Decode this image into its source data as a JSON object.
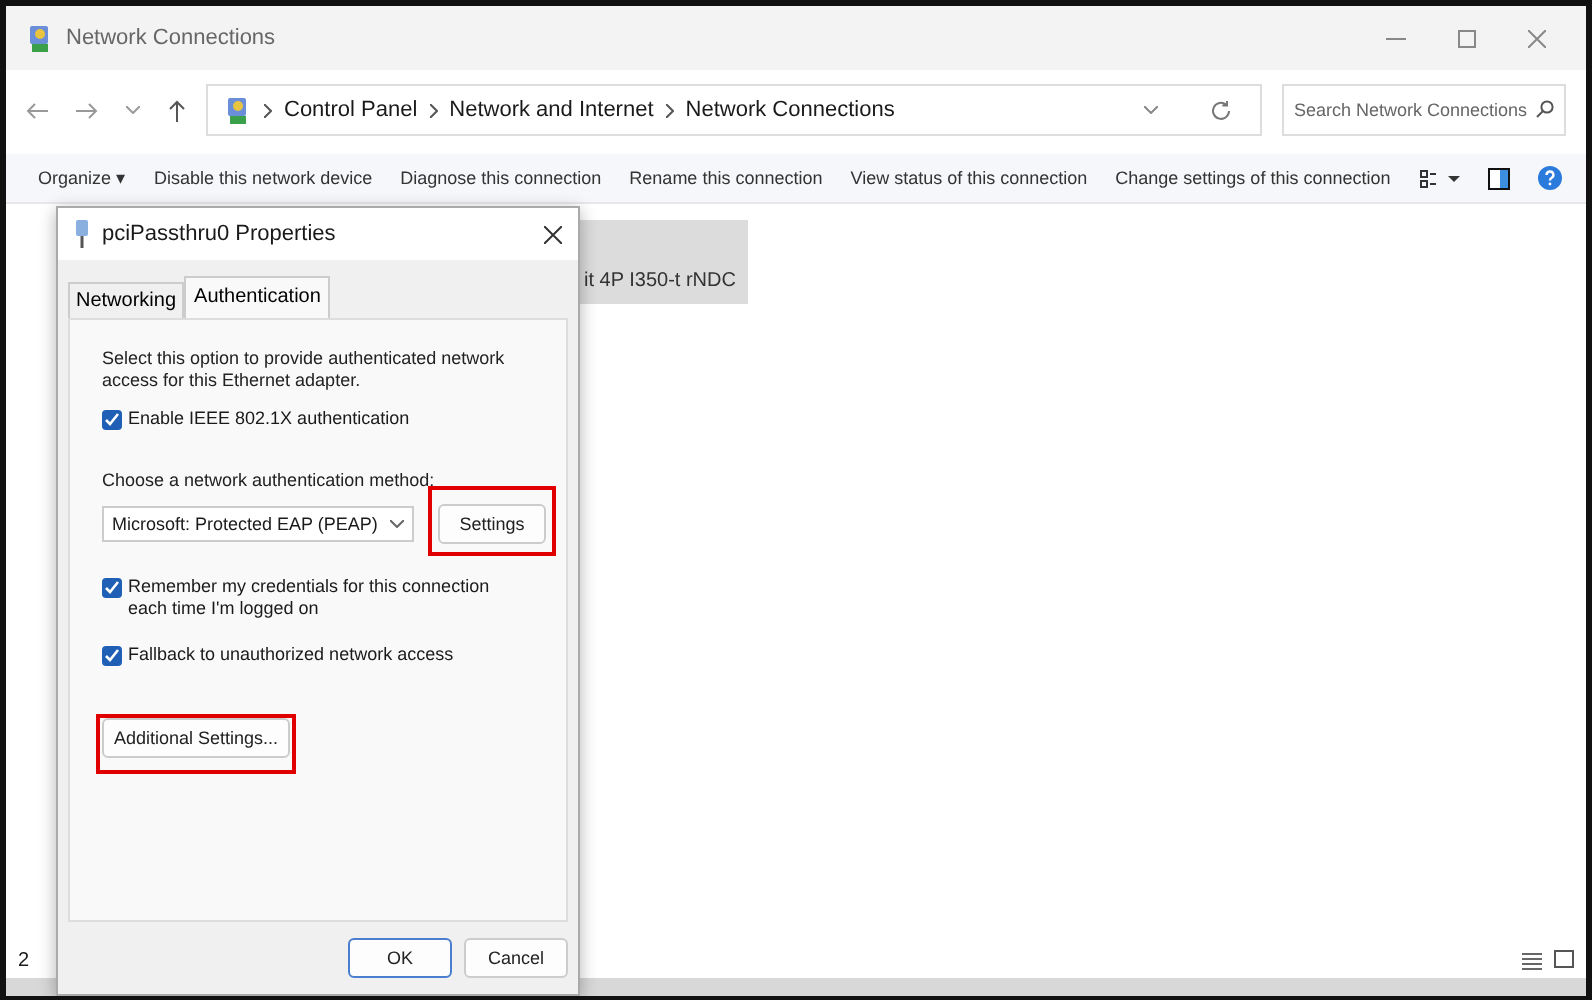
{
  "window": {
    "title": "Network Connections"
  },
  "address_bar": {
    "path": [
      "Control Panel",
      "Network and Internet",
      "Network Connections"
    ]
  },
  "search": {
    "placeholder": "Search Network Connections"
  },
  "toolbar": [
    "Organize ▾",
    "Disable this network device",
    "Diagnose this connection",
    "Rename this connection",
    "View status of this connection",
    "Change settings of this connection"
  ],
  "connection_tile": {
    "label": "it 4P I350-t rNDC",
    "selected": true
  },
  "status_bar": {
    "count": "2"
  },
  "dialog": {
    "title": "pciPassthru0 Properties",
    "tabs": [
      {
        "label": "Networking",
        "selected": false
      },
      {
        "label": "Authentication",
        "selected": true
      }
    ],
    "intro": "Select this option to provide authenticated network access for this Ethernet adapter.",
    "enable_checkbox": {
      "label": "Enable IEEE 802.1X authentication",
      "checked": true
    },
    "method_label": "Choose a network authentication method:",
    "method": {
      "value": "Microsoft: Protected EAP (PEAP)"
    },
    "settings_button": {
      "label": "Settings",
      "highlighted": true
    },
    "options": [
      {
        "label": "Remember my credentials for this connection each time I'm logged on",
        "checked": true
      },
      {
        "label": "Fallback to unauthorized network access",
        "checked": true
      }
    ],
    "additional_button": {
      "label": "Additional Settings...",
      "highlighted": true
    },
    "buttons": [
      {
        "label": "OK",
        "default": true
      },
      {
        "label": "Cancel",
        "default": false
      }
    ]
  }
}
